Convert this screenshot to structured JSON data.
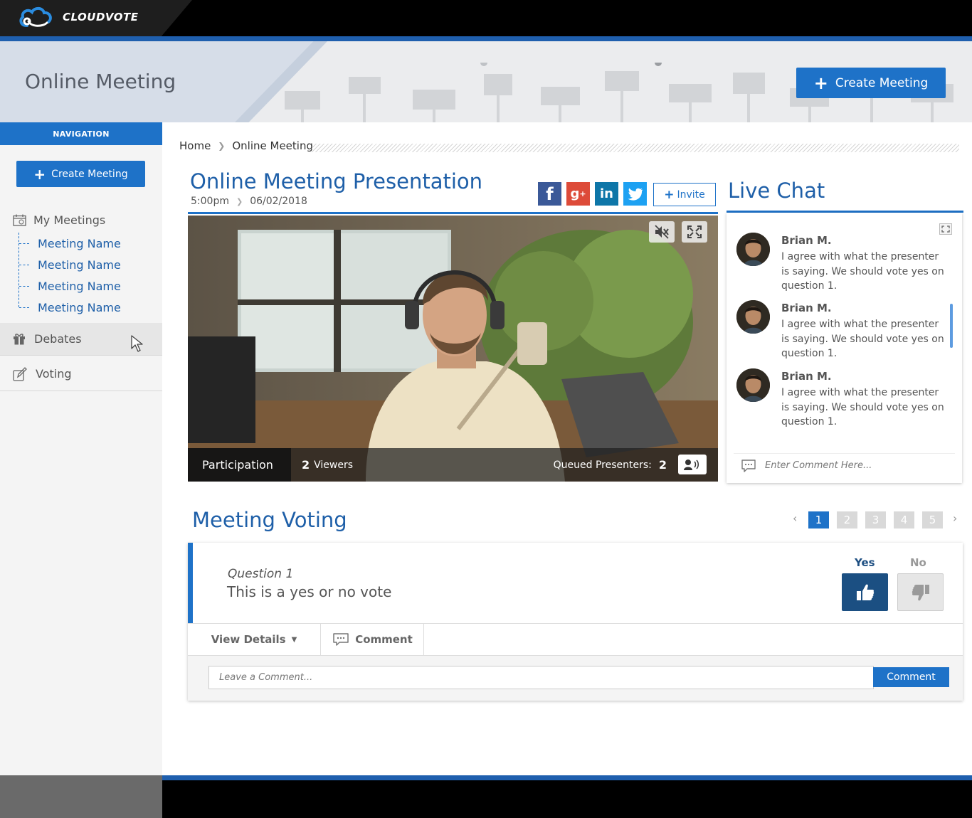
{
  "header": {
    "logo_text": "CLOUDVOTE"
  },
  "banner": {
    "title": "Online Meeting",
    "create_button": "Create Meeting"
  },
  "sidebar": {
    "nav_header": "NAVIGATION",
    "create_button": "Create Meeting",
    "my_meetings": "My Meetings",
    "meetings": [
      "Meeting Name",
      "Meeting Name",
      "Meeting Name",
      "Meeting Name"
    ],
    "debates": "Debates",
    "voting": "Voting"
  },
  "breadcrumb": {
    "home": "Home",
    "current": "Online Meeting"
  },
  "presentation": {
    "title": "Online Meeting Presentation",
    "time": "5:00pm",
    "date": "06/02/2018",
    "invite_button": "Invite",
    "social": [
      "facebook-icon",
      "google-plus-icon",
      "linkedin-icon",
      "twitter-icon"
    ]
  },
  "video": {
    "participation_label": "Participation",
    "viewers_count": "2",
    "viewers_label": "Viewers",
    "queued_label": "Queued Presenters:",
    "queued_count": "2"
  },
  "chat": {
    "title": "Live Chat",
    "messages": [
      {
        "name": "Brian M.",
        "text": "I agree with what the presenter is saying. We should vote yes on question 1."
      },
      {
        "name": "Brian M.",
        "text": "I agree with what the presenter is saying. We should vote yes on question 1."
      },
      {
        "name": "Brian M.",
        "text": "I agree with what the presenter is saying. We should vote yes on question 1."
      }
    ],
    "input_placeholder": "Enter Comment Here..."
  },
  "voting": {
    "title": "Meeting Voting",
    "pages": [
      "1",
      "2",
      "3",
      "4",
      "5"
    ],
    "active_page": "1",
    "question_label": "Question 1",
    "question_text": "This is a yes or no vote",
    "yes_label": "Yes",
    "no_label": "No",
    "view_details": "View Details",
    "comment_tab": "Comment",
    "comment_placeholder": "Leave a Comment...",
    "comment_button": "Comment"
  },
  "colors": {
    "accent": "#1e72c8",
    "title_blue": "#1e5fa8",
    "yes_active": "#1b4f82"
  }
}
